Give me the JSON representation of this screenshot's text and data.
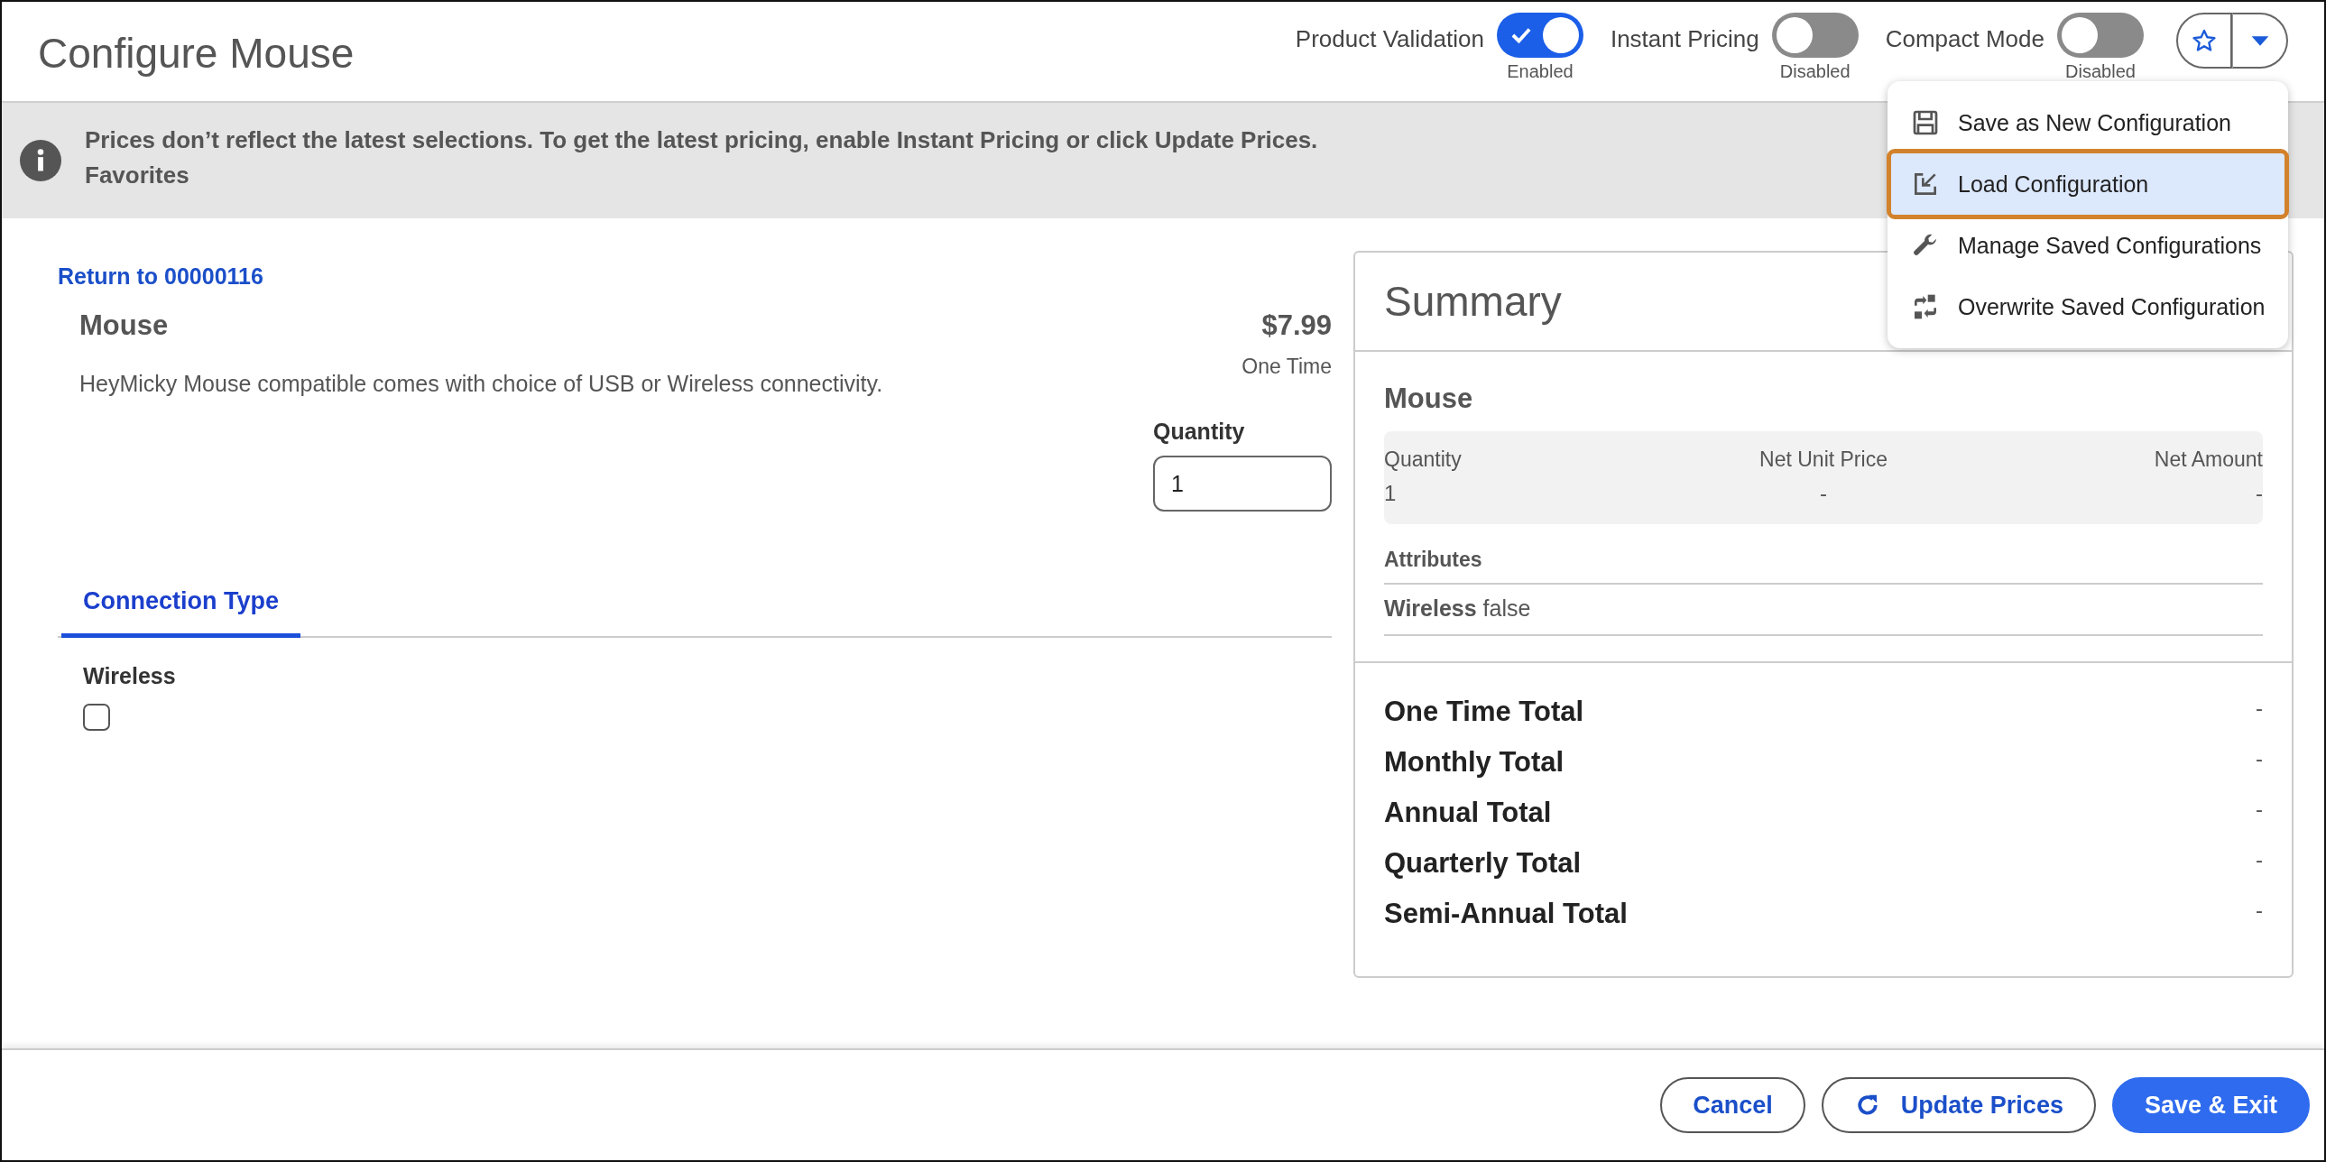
{
  "header": {
    "title": "Configure Mouse",
    "toggles": [
      {
        "label": "Product Validation",
        "on": true,
        "status": "Enabled"
      },
      {
        "label": "Instant Pricing",
        "on": false,
        "status": "Disabled"
      },
      {
        "label": "Compact Mode",
        "on": false,
        "status": "Disabled"
      }
    ]
  },
  "menu": {
    "expanded": true,
    "items": [
      {
        "kind": "save",
        "label": "Save as New Configuration",
        "selected": false
      },
      {
        "kind": "load",
        "label": "Load Configuration",
        "selected": true
      },
      {
        "kind": "manage",
        "label": "Manage Saved Configurations",
        "selected": false
      },
      {
        "kind": "overwrite",
        "label": "Overwrite Saved Configuration",
        "selected": false
      }
    ]
  },
  "banner": {
    "message": "Prices don’t reflect the latest selections. To get the latest pricing, enable Instant Pricing or click Update Prices.",
    "sub": "Favorites"
  },
  "product": {
    "return_link": "Return to 00000116",
    "name": "Mouse",
    "price": "$7.99",
    "price_type": "One Time",
    "description": "HeyMicky Mouse compatible comes with choice of USB or Wireless connectivity.",
    "quantity_label": "Quantity",
    "quantity": "1"
  },
  "tabs": [
    {
      "label": "Connection Type",
      "selected": true
    }
  ],
  "attributes": [
    {
      "label": "Wireless",
      "checked": false
    }
  ],
  "summary": {
    "title": "Summary",
    "product": "Mouse",
    "columns": [
      {
        "label": "Quantity",
        "value": "1"
      },
      {
        "label": "Net Unit Price",
        "value": "-"
      },
      {
        "label": "Net Amount",
        "value": "-"
      }
    ],
    "attributes_label": "Attributes",
    "attributes": [
      {
        "name": "Wireless",
        "value": "false"
      }
    ],
    "totals": [
      {
        "label": "One Time Total",
        "value": "-"
      },
      {
        "label": "Monthly Total",
        "value": "-"
      },
      {
        "label": "Annual Total",
        "value": "-"
      },
      {
        "label": "Quarterly Total",
        "value": "-"
      },
      {
        "label": "Semi-Annual Total",
        "value": "-"
      }
    ]
  },
  "footer": {
    "buttons": [
      {
        "kind": "outline",
        "label": "Cancel"
      },
      {
        "kind": "refresh",
        "label": "Update Prices"
      },
      {
        "kind": "primary",
        "label": "Save & Exit"
      }
    ]
  }
}
